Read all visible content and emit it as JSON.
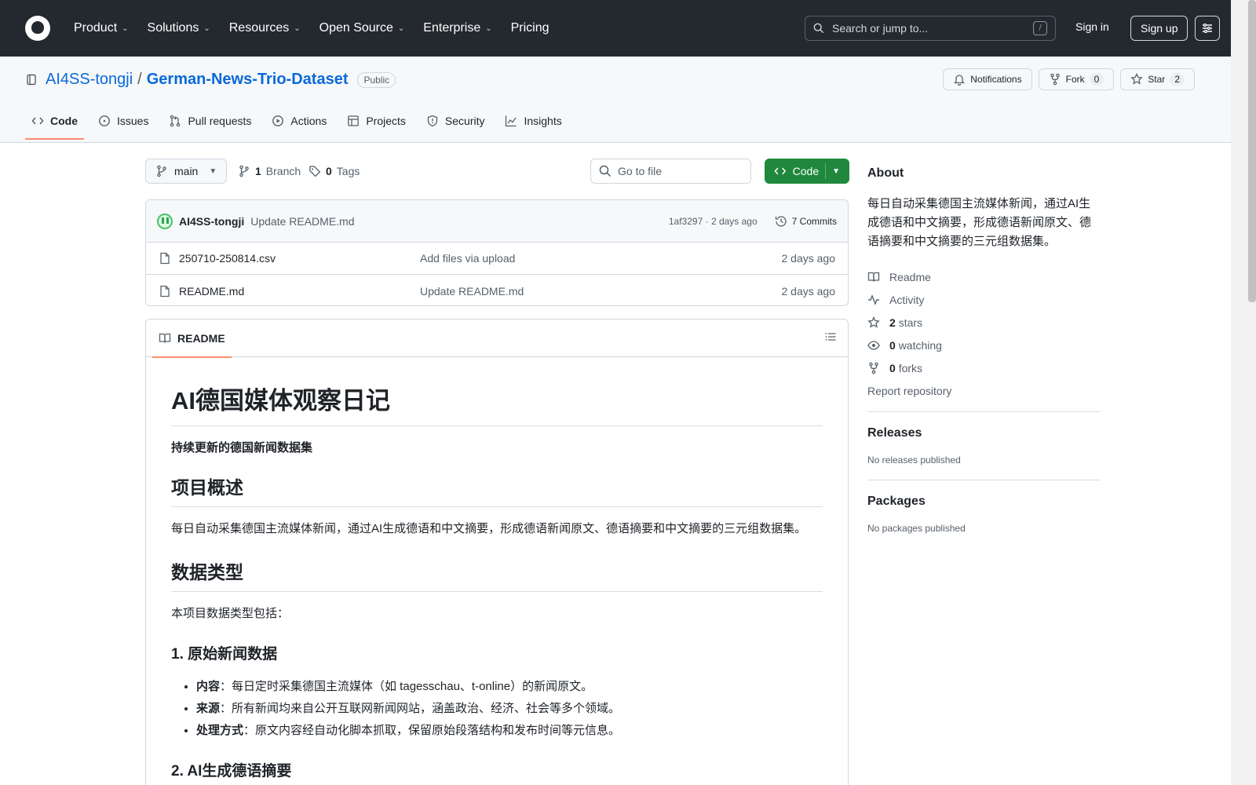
{
  "header": {
    "nav": [
      {
        "label": "Product",
        "has_menu": true
      },
      {
        "label": "Solutions",
        "has_menu": true
      },
      {
        "label": "Resources",
        "has_menu": true
      },
      {
        "label": "Open Source",
        "has_menu": true
      },
      {
        "label": "Enterprise",
        "has_menu": true
      },
      {
        "label": "Pricing",
        "has_menu": false
      }
    ],
    "search_placeholder": "Search or jump to...",
    "search_shortcut": "/",
    "sign_in": "Sign in",
    "sign_up": "Sign up"
  },
  "repo": {
    "owner": "AI4SS-tongji",
    "separator": "/",
    "name": "German-News-Trio-Dataset",
    "visibility": "Public",
    "notifications": "Notifications",
    "fork_label": "Fork",
    "fork_count": "0",
    "star_label": "Star",
    "star_count": "2",
    "tabs": [
      {
        "label": "Code",
        "icon": "code-icon",
        "active": true
      },
      {
        "label": "Issues",
        "icon": "issue-icon",
        "active": false
      },
      {
        "label": "Pull requests",
        "icon": "pull-request-icon",
        "active": false
      },
      {
        "label": "Actions",
        "icon": "play-icon",
        "active": false
      },
      {
        "label": "Projects",
        "icon": "table-icon",
        "active": false
      },
      {
        "label": "Security",
        "icon": "shield-icon",
        "active": false
      },
      {
        "label": "Insights",
        "icon": "graph-icon",
        "active": false
      }
    ]
  },
  "toolbar": {
    "branch": "main",
    "branch_count": "1",
    "branch_label": "Branch",
    "tag_count": "0",
    "tag_label": "Tags",
    "go_to_file": "Go to file",
    "code_button": "Code"
  },
  "latest_commit": {
    "author": "AI4SS-tongji",
    "message": "Update README.md",
    "hash": "1af3297",
    "time": "2 days ago",
    "meta_separator": "·",
    "commits_label": "7 Commits"
  },
  "files": [
    {
      "name": "250710-250814.csv",
      "message": "Add files via upload",
      "date": "2 days ago"
    },
    {
      "name": "README.md",
      "message": "Update README.md",
      "date": "2 days ago"
    }
  ],
  "readme": {
    "tab_label": "README",
    "title": "AI德国媒体观察日记",
    "lead": "持续更新的德国新闻数据集",
    "h2_overview": "项目概述",
    "overview_text": "每日自动采集德国主流媒体新闻，通过AI生成德语和中文摘要，形成德语新闻原文、德语摘要和中文摘要的三元组数据集。",
    "h2_types": "数据类型",
    "types_text": "本项目数据类型包括：",
    "h3_raw": "1. 原始新闻数据",
    "raw_items": [
      {
        "label": "内容",
        "text": "：每日定时采集德国主流媒体（如 tagesschau、t-online）的新闻原文。"
      },
      {
        "label": "来源",
        "text": "：所有新闻均来自公开互联网新闻网站，涵盖政治、经济、社会等多个领域。"
      },
      {
        "label": "处理方式",
        "text": "：原文内容经自动化脚本抓取，保留原始段落结构和发布时间等元信息。"
      }
    ],
    "h3_ai": "2. AI生成德语摘要"
  },
  "about": {
    "title": "About",
    "description": "每日自动采集德国主流媒体新闻，通过AI生成德语和中文摘要，形成德语新闻原文、德语摘要和中文摘要的三元组数据集。",
    "readme": "Readme",
    "activity": "Activity",
    "stars_count": "2",
    "stars_label": "stars",
    "watching_count": "0",
    "watching_label": "watching",
    "forks_count": "0",
    "forks_label": "forks",
    "report": "Report repository",
    "releases_title": "Releases",
    "releases_text": "No releases published",
    "packages_title": "Packages",
    "packages_text": "No packages published"
  },
  "colors": {
    "accent": "#0969da",
    "code_button": "#1f883d",
    "tab_underline": "#fd8c73",
    "header_bg": "#24292f"
  }
}
